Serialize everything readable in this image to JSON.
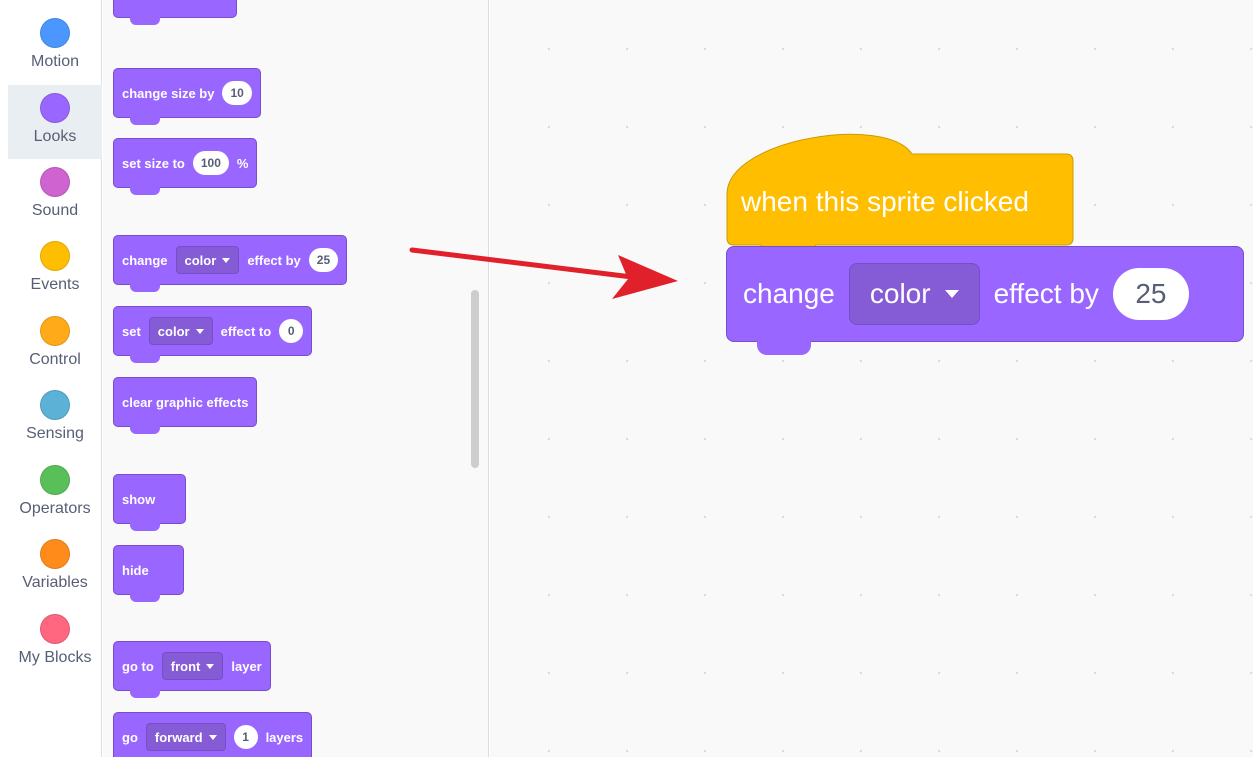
{
  "categories": [
    {
      "label": "Motion",
      "color": "#4c97ff"
    },
    {
      "label": "Looks",
      "color": "#9966ff",
      "selected": true
    },
    {
      "label": "Sound",
      "color": "#cf63cf"
    },
    {
      "label": "Events",
      "color": "#ffbf00"
    },
    {
      "label": "Control",
      "color": "#ffab19"
    },
    {
      "label": "Sensing",
      "color": "#5cb1d6"
    },
    {
      "label": "Operators",
      "color": "#59c059"
    },
    {
      "label": "Variables",
      "color": "#ff8c1a"
    },
    {
      "label": "My Blocks",
      "color": "#ff6680"
    }
  ],
  "palette": {
    "change_size": {
      "text": "change size by",
      "value": "10"
    },
    "set_size": {
      "text": "set size to",
      "value": "100",
      "suffix": "%"
    },
    "change_effect": {
      "text": "change",
      "dropdown": "color",
      "text2": "effect by",
      "value": "25"
    },
    "set_effect": {
      "text": "set",
      "dropdown": "color",
      "text2": "effect to",
      "value": "0"
    },
    "clear_effects": {
      "text": "clear graphic effects"
    },
    "show": {
      "text": "show"
    },
    "hide": {
      "text": "hide"
    },
    "go_to_layer": {
      "text": "go to",
      "dropdown": "front",
      "text2": "layer"
    },
    "go_layers": {
      "text": "go",
      "dropdown": "forward",
      "value": "1",
      "text2": "layers"
    }
  },
  "script": {
    "hat": {
      "text": "when this sprite clicked",
      "color": "#ffbf00"
    },
    "command": {
      "text": "change",
      "dropdown": "color",
      "text2": "effect by",
      "value": "25",
      "color": "#9966ff"
    }
  },
  "colors": {
    "looks": "#9966ff",
    "looks_dark": "#774dcb",
    "events": "#ffbf00",
    "arrow": "#e0202a"
  }
}
